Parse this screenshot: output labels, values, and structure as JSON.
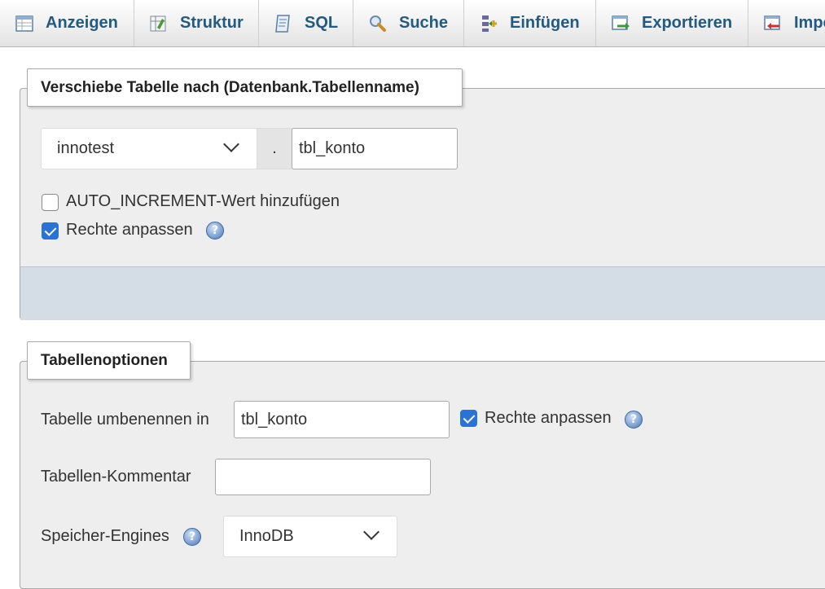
{
  "tabs": [
    {
      "label": "Anzeigen",
      "icon": "browse-table-icon"
    },
    {
      "label": "Struktur",
      "icon": "structure-icon"
    },
    {
      "label": "SQL",
      "icon": "sql-icon"
    },
    {
      "label": "Suche",
      "icon": "search-icon"
    },
    {
      "label": "Einfügen",
      "icon": "insert-icon"
    },
    {
      "label": "Exportieren",
      "icon": "export-icon"
    },
    {
      "label": "Importieren",
      "icon": "import-icon"
    }
  ],
  "move_table": {
    "legend": "Verschiebe Tabelle nach (Datenbank.Tabellenname)",
    "database_select": "innotest",
    "separator": ".",
    "table_name": "tbl_konto",
    "auto_increment_label": "AUTO_INCREMENT-Wert hinzufügen",
    "auto_increment_checked": false,
    "adjust_privileges_label": "Rechte anpassen",
    "adjust_privileges_checked": true
  },
  "table_options": {
    "legend": "Tabellenoptionen",
    "rename_label": "Tabelle umbenennen in",
    "rename_value": "tbl_konto",
    "rename_privileges_label": "Rechte anpassen",
    "rename_privileges_checked": true,
    "comment_label": "Tabellen-Kommentar",
    "comment_value": "",
    "engine_label": "Speicher-Engines",
    "engine_value": "InnoDB"
  },
  "colors": {
    "tab_text": "#235a81",
    "panel_bg": "#eeeeee",
    "footer_bg": "#d4dde6",
    "checkbox_checked": "#2a73d6"
  }
}
